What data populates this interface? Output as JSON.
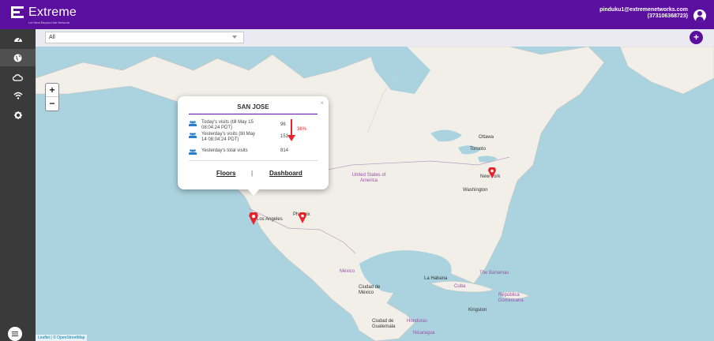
{
  "header": {
    "brand": "Extreme",
    "tagline": "Let Next Beyond the Network",
    "user_email": "pinduku1@extremenetworks.com",
    "user_id": "(373106368723)"
  },
  "sidebar": {
    "items": [
      {
        "icon": "dashboard-icon"
      },
      {
        "icon": "globe-icon",
        "active": true
      },
      {
        "icon": "cloud-icon"
      },
      {
        "icon": "wifi-icon"
      },
      {
        "icon": "gear-icon"
      }
    ]
  },
  "filter": {
    "selected": "All"
  },
  "map": {
    "zoom_in": "+",
    "zoom_out": "−",
    "attribution": "Leaflet | © OpenStreetMap",
    "labels": {
      "ottawa": "Ottawa",
      "toronto": "Toronto",
      "newyork": "New York",
      "washington": "Washington",
      "usa": "United States of America",
      "losangeles": "Los Angeles",
      "phoenix": "Phoenix",
      "mexico": "México",
      "mexicocity": "Ciudad de México",
      "lahabana": "La Habana",
      "bahamas": "The Bahamas",
      "cuba": "Cuba",
      "dominican": "República Dominicana",
      "kingston": "Kingston",
      "guatemala": "Ciudad de Guatemala",
      "honduras": "Honduras",
      "nicaragua": "Nicaragua"
    }
  },
  "popup": {
    "title": "SAN JOSE",
    "close": "×",
    "today_label": "Today's visits (till May 15 08:04:24 PDT)",
    "today_value": "96",
    "yesterday_label": "Yesterday's visits (till May 14 08:04:24 PDT)",
    "yesterday_value": "151",
    "total_label": "Yesterday's total visits",
    "total_value": "814",
    "change_pct": "36%",
    "floors": "Floors",
    "separator": "|",
    "dashboard": "Dashboard"
  },
  "colors": {
    "header": "#5a0f9e",
    "sidebar": "#3a3a3a",
    "pin": "#e8232a",
    "water": "#aad3df",
    "land": "#f2efe9"
  }
}
